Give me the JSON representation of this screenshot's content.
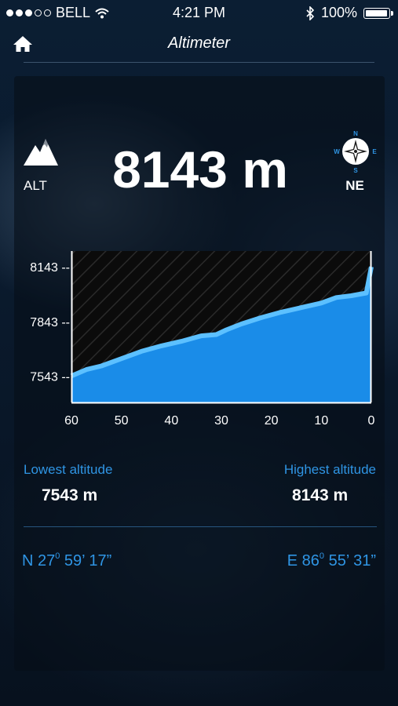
{
  "status_bar": {
    "carrier": "BELL",
    "time": "4:21 PM",
    "battery": "100%",
    "signal_bars": 3,
    "signal_total": 5,
    "battery_level": 1.0
  },
  "nav": {
    "title": "Altimeter",
    "home_icon": "home-icon"
  },
  "altitude": {
    "label": "ALT",
    "value": "8143 m",
    "icon": "mountain-icon"
  },
  "direction": {
    "value": "NE",
    "compass": {
      "n": "N",
      "e": "E",
      "s": "S",
      "w": "W"
    }
  },
  "chart_data": {
    "type": "area",
    "x": [
      60,
      57,
      54,
      50,
      46,
      42,
      38,
      34,
      31,
      29,
      26,
      22,
      18,
      14,
      10,
      7,
      4,
      1,
      0
    ],
    "values": [
      7545,
      7580,
      7600,
      7640,
      7680,
      7710,
      7735,
      7765,
      7772,
      7798,
      7830,
      7865,
      7895,
      7920,
      7945,
      7975,
      7985,
      8000,
      8143
    ],
    "x_ticks": [
      "60",
      "50",
      "40",
      "30",
      "20",
      "10",
      "0"
    ],
    "y_ticks": [
      "8143 --",
      "7843 --",
      "7543 --"
    ],
    "xlim": [
      60,
      0
    ],
    "ylim": [
      7400,
      8230
    ],
    "xlabel": "",
    "ylabel": "",
    "colors": {
      "fill": "#1a8ce8",
      "line": "#5cc0ff",
      "background": "#0b0b0b"
    }
  },
  "stats": {
    "lowest_label": "Lowest altitude",
    "lowest_value": "7543 m",
    "highest_label": "Highest altitude",
    "highest_value": "8143 m"
  },
  "coords": {
    "lat_prefix": "N 27",
    "lat_deg": "0",
    "lat_rest": " 59’ 17”",
    "lon_prefix": "E 86",
    "lon_deg": "0",
    "lon_rest": " 55’ 31”"
  },
  "colors": {
    "accent": "#2f95e4"
  }
}
